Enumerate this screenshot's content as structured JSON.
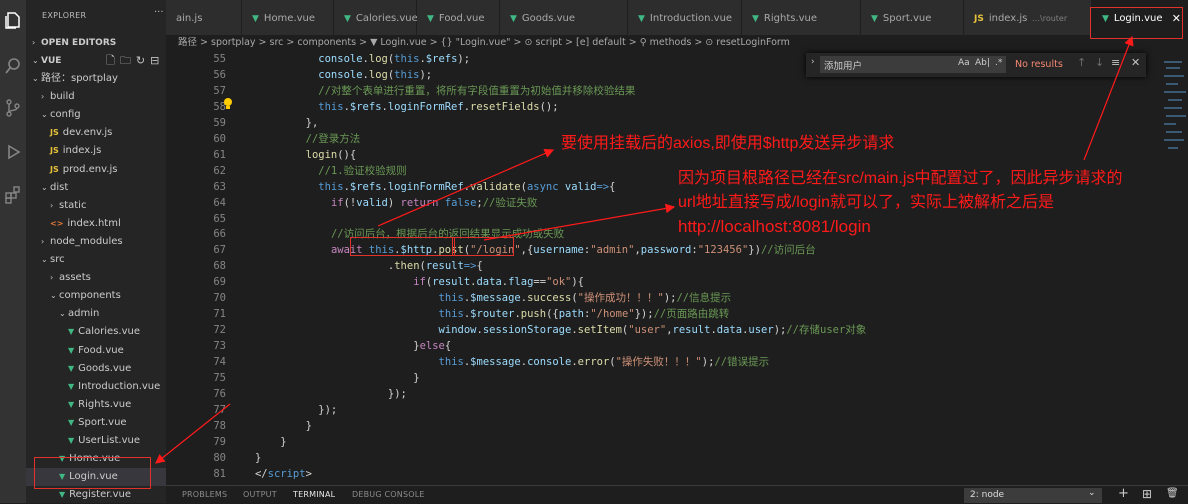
{
  "sidebar": {
    "title": "EXPLORER",
    "open_editors": "OPEN EDITORS",
    "root": "VUE",
    "tree": [
      {
        "label": "路径：sportplay",
        "type": "folder",
        "open": true,
        "depth": 1
      },
      {
        "label": "build",
        "type": "folder",
        "open": false,
        "depth": 2
      },
      {
        "label": "config",
        "type": "folder",
        "open": true,
        "depth": 2
      },
      {
        "label": "dev.env.js",
        "type": "js",
        "depth": 3
      },
      {
        "label": "index.js",
        "type": "js",
        "depth": 3
      },
      {
        "label": "prod.env.js",
        "type": "js",
        "depth": 3
      },
      {
        "label": "dist",
        "type": "folder",
        "open": true,
        "depth": 2
      },
      {
        "label": "static",
        "type": "folder",
        "open": false,
        "depth": 3
      },
      {
        "label": "index.html",
        "type": "html",
        "depth": 3
      },
      {
        "label": "node_modules",
        "type": "folder",
        "open": false,
        "depth": 2
      },
      {
        "label": "src",
        "type": "folder",
        "open": true,
        "depth": 2
      },
      {
        "label": "assets",
        "type": "folder",
        "open": false,
        "depth": 3
      },
      {
        "label": "components",
        "type": "folder",
        "open": true,
        "depth": 3
      },
      {
        "label": "admin",
        "type": "folder",
        "open": true,
        "depth": 4
      },
      {
        "label": "Calories.vue",
        "type": "vue",
        "depth": 5
      },
      {
        "label": "Food.vue",
        "type": "vue",
        "depth": 5
      },
      {
        "label": "Goods.vue",
        "type": "vue",
        "depth": 5
      },
      {
        "label": "Introduction.vue",
        "type": "vue",
        "depth": 5
      },
      {
        "label": "Rights.vue",
        "type": "vue",
        "depth": 5
      },
      {
        "label": "Sport.vue",
        "type": "vue",
        "depth": 5
      },
      {
        "label": "UserList.vue",
        "type": "vue",
        "depth": 5
      },
      {
        "label": "Home.vue",
        "type": "vue",
        "depth": 4
      },
      {
        "label": "Login.vue",
        "type": "vue",
        "depth": 4,
        "selected": true
      },
      {
        "label": "Register.vue",
        "type": "vue",
        "depth": 4
      }
    ]
  },
  "tabs": [
    {
      "label": "main.js",
      "icon": "JS",
      "type": "js",
      "visible_label": "ain.js"
    },
    {
      "label": "Home.vue",
      "icon": "V",
      "type": "vue"
    },
    {
      "label": "Calories.vue",
      "icon": "V",
      "type": "vue"
    },
    {
      "label": "Food.vue",
      "icon": "V",
      "type": "vue"
    },
    {
      "label": "Goods.vue",
      "icon": "V",
      "type": "vue"
    },
    {
      "label": "Introduction.vue",
      "icon": "V",
      "type": "vue"
    },
    {
      "label": "Rights.vue",
      "icon": "V",
      "type": "vue"
    },
    {
      "label": "Sport.vue",
      "icon": "V",
      "type": "vue"
    },
    {
      "label": "index.js",
      "icon": "JS",
      "type": "js",
      "suffix": "...\\router"
    },
    {
      "label": "Login.vue",
      "icon": "V",
      "type": "vue",
      "active": true
    }
  ],
  "breadcrumb": "路径 > sportplay > src > components > ▼ Login.vue > {} \"Login.vue\" > ⊙ script > [e] default > ⚲ methods > ⊙ resetLoginForm",
  "find": {
    "value": "添加用户",
    "case_label": "Aa",
    "word_label": "Ab|",
    "regex_label": ".*",
    "result": "No results"
  },
  "code": [
    {
      "n": "55",
      "indent": 13,
      "tokens": [
        [
          "c-prop",
          "console"
        ],
        [
          "c-txt",
          "."
        ],
        [
          "c-fn",
          "log"
        ],
        [
          "c-txt",
          "("
        ],
        [
          "c-this",
          "this"
        ],
        [
          "c-txt",
          "."
        ],
        [
          "c-prop",
          "$refs"
        ],
        [
          "c-txt",
          ");"
        ]
      ]
    },
    {
      "n": "56",
      "indent": 13,
      "tokens": [
        [
          "c-prop",
          "console"
        ],
        [
          "c-txt",
          "."
        ],
        [
          "c-fn",
          "log"
        ],
        [
          "c-txt",
          "("
        ],
        [
          "c-this",
          "this"
        ],
        [
          "c-txt",
          ");"
        ]
      ]
    },
    {
      "n": "57",
      "indent": 13,
      "tokens": [
        [
          "c-cm",
          "//对整个表单进行重置，将所有字段值重置为初始值并移除校验结果"
        ]
      ]
    },
    {
      "n": "58",
      "indent": 13,
      "tokens": [
        [
          "c-this",
          "this"
        ],
        [
          "c-txt",
          "."
        ],
        [
          "c-prop",
          "$refs"
        ],
        [
          "c-txt",
          "."
        ],
        [
          "c-prop",
          "loginFormRef"
        ],
        [
          "c-txt",
          "."
        ],
        [
          "c-fn",
          "resetFields"
        ],
        [
          "c-txt",
          "();"
        ]
      ]
    },
    {
      "n": "59",
      "indent": 11,
      "tokens": [
        [
          "c-txt",
          "},"
        ]
      ]
    },
    {
      "n": "60",
      "indent": 11,
      "tokens": [
        [
          "c-cm",
          "//登录方法"
        ]
      ]
    },
    {
      "n": "61",
      "indent": 11,
      "tokens": [
        [
          "c-fn",
          "login"
        ],
        [
          "c-txt",
          "(){"
        ]
      ]
    },
    {
      "n": "62",
      "indent": 13,
      "tokens": [
        [
          "c-cm",
          "//1.验证校验规则"
        ]
      ]
    },
    {
      "n": "63",
      "indent": 13,
      "tokens": [
        [
          "c-this",
          "this"
        ],
        [
          "c-txt",
          "."
        ],
        [
          "c-prop",
          "$refs"
        ],
        [
          "c-txt",
          "."
        ],
        [
          "c-prop",
          "loginFormRef"
        ],
        [
          "c-txt",
          "."
        ],
        [
          "c-fn",
          "validate"
        ],
        [
          "c-txt",
          "("
        ],
        [
          "c-kw2",
          "async"
        ],
        [
          "c-txt",
          " "
        ],
        [
          "c-prop",
          "valid"
        ],
        [
          "c-kw2",
          "=>"
        ],
        [
          "c-txt",
          "{"
        ]
      ]
    },
    {
      "n": "64",
      "indent": 15,
      "tokens": [
        [
          "c-kw",
          "if"
        ],
        [
          "c-txt",
          "(!"
        ],
        [
          "c-prop",
          "valid"
        ],
        [
          "c-txt",
          ") "
        ],
        [
          "c-kw",
          "return"
        ],
        [
          "c-txt",
          " "
        ],
        [
          "c-kw2",
          "false"
        ],
        [
          "c-txt",
          ";"
        ],
        [
          "c-cm",
          "//验证失败"
        ]
      ]
    },
    {
      "n": "65",
      "indent": 0,
      "tokens": []
    },
    {
      "n": "66",
      "indent": 15,
      "tokens": [
        [
          "c-cm",
          "//访问后台，根据后台的返回结果显示成功或失败"
        ]
      ]
    },
    {
      "n": "67",
      "indent": 15,
      "tokens": [
        [
          "c-kw",
          "await"
        ],
        [
          "c-txt",
          " "
        ],
        [
          "c-this",
          "this"
        ],
        [
          "c-txt",
          "."
        ],
        [
          "c-prop",
          "$http"
        ],
        [
          "c-txt",
          "."
        ],
        [
          "c-fn",
          "post"
        ],
        [
          "c-txt",
          "("
        ],
        [
          "c-str",
          "\"/login\""
        ],
        [
          "c-txt",
          ",{"
        ],
        [
          "c-prop",
          "username"
        ],
        [
          "c-txt",
          ":"
        ],
        [
          "c-str",
          "\"admin\""
        ],
        [
          "c-txt",
          ","
        ],
        [
          "c-prop",
          "password"
        ],
        [
          "c-txt",
          ":"
        ],
        [
          "c-str",
          "\"123456\""
        ],
        [
          "c-txt",
          "})"
        ],
        [
          "c-cm",
          "//访问后台"
        ]
      ]
    },
    {
      "n": "68",
      "indent": 24,
      "tokens": [
        [
          "c-txt",
          "."
        ],
        [
          "c-fn",
          "then"
        ],
        [
          "c-txt",
          "("
        ],
        [
          "c-prop",
          "result"
        ],
        [
          "c-kw2",
          "=>"
        ],
        [
          "c-txt",
          "{"
        ]
      ]
    },
    {
      "n": "69",
      "indent": 28,
      "tokens": [
        [
          "c-kw",
          "if"
        ],
        [
          "c-txt",
          "("
        ],
        [
          "c-prop",
          "result"
        ],
        [
          "c-txt",
          "."
        ],
        [
          "c-prop",
          "data"
        ],
        [
          "c-txt",
          "."
        ],
        [
          "c-prop",
          "flag"
        ],
        [
          "c-txt",
          "=="
        ],
        [
          "c-str",
          "\"ok\""
        ],
        [
          "c-txt",
          "){"
        ]
      ]
    },
    {
      "n": "70",
      "indent": 32,
      "tokens": [
        [
          "c-this",
          "this"
        ],
        [
          "c-txt",
          "."
        ],
        [
          "c-prop",
          "$message"
        ],
        [
          "c-txt",
          "."
        ],
        [
          "c-fn",
          "success"
        ],
        [
          "c-txt",
          "("
        ],
        [
          "c-str",
          "\"操作成功！！！\""
        ],
        [
          "c-txt",
          ");"
        ],
        [
          "c-cm",
          "//信息提示"
        ]
      ]
    },
    {
      "n": "71",
      "indent": 32,
      "tokens": [
        [
          "c-this",
          "this"
        ],
        [
          "c-txt",
          "."
        ],
        [
          "c-prop",
          "$router"
        ],
        [
          "c-txt",
          "."
        ],
        [
          "c-fn",
          "push"
        ],
        [
          "c-txt",
          "({"
        ],
        [
          "c-prop",
          "path"
        ],
        [
          "c-txt",
          ":"
        ],
        [
          "c-str",
          "\"/home\""
        ],
        [
          "c-txt",
          "});"
        ],
        [
          "c-cm",
          "//页面路由跳转"
        ]
      ]
    },
    {
      "n": "72",
      "indent": 32,
      "tokens": [
        [
          "c-prop",
          "window"
        ],
        [
          "c-txt",
          "."
        ],
        [
          "c-prop",
          "sessionStorage"
        ],
        [
          "c-txt",
          "."
        ],
        [
          "c-fn",
          "setItem"
        ],
        [
          "c-txt",
          "("
        ],
        [
          "c-str",
          "\"user\""
        ],
        [
          "c-txt",
          ","
        ],
        [
          "c-prop",
          "result"
        ],
        [
          "c-txt",
          "."
        ],
        [
          "c-prop",
          "data"
        ],
        [
          "c-txt",
          "."
        ],
        [
          "c-prop",
          "user"
        ],
        [
          "c-txt",
          ");"
        ],
        [
          "c-cm",
          "//存储user对象"
        ]
      ]
    },
    {
      "n": "73",
      "indent": 28,
      "tokens": [
        [
          "c-txt",
          "}"
        ],
        [
          "c-kw",
          "else"
        ],
        [
          "c-txt",
          "{"
        ]
      ]
    },
    {
      "n": "74",
      "indent": 32,
      "tokens": [
        [
          "c-this",
          "this"
        ],
        [
          "c-txt",
          "."
        ],
        [
          "c-prop",
          "$message"
        ],
        [
          "c-txt",
          "."
        ],
        [
          "c-prop",
          "console"
        ],
        [
          "c-txt",
          "."
        ],
        [
          "c-fn",
          "error"
        ],
        [
          "c-txt",
          "("
        ],
        [
          "c-str",
          "\"操作失败！！！\""
        ],
        [
          "c-txt",
          ");"
        ],
        [
          "c-cm",
          "//错误提示"
        ]
      ]
    },
    {
      "n": "75",
      "indent": 28,
      "tokens": [
        [
          "c-txt",
          "}"
        ]
      ]
    },
    {
      "n": "76",
      "indent": 24,
      "tokens": [
        [
          "c-txt",
          "});"
        ]
      ]
    },
    {
      "n": "77",
      "indent": 13,
      "tokens": [
        [
          "c-txt",
          "});"
        ]
      ]
    },
    {
      "n": "78",
      "indent": 11,
      "tokens": [
        [
          "c-txt",
          "}"
        ]
      ]
    },
    {
      "n": "79",
      "indent": 7,
      "tokens": [
        [
          "c-txt",
          "}"
        ]
      ]
    },
    {
      "n": "80",
      "indent": 3,
      "tokens": [
        [
          "c-txt",
          "}"
        ]
      ]
    },
    {
      "n": "81",
      "indent": 3,
      "tokens": [
        [
          "c-txt",
          "</"
        ],
        [
          "c-kw2",
          "script"
        ],
        [
          "c-txt",
          ">"
        ]
      ]
    },
    {
      "n": "82",
      "indent": 3,
      "tokens": [
        [
          "c-txt",
          "<"
        ],
        [
          "c-kw2",
          "style"
        ],
        [
          "c-txt",
          " "
        ],
        [
          "c-prop",
          "scoped"
        ],
        [
          "c-txt",
          ">"
        ]
      ]
    }
  ],
  "annotations": {
    "a1": "要使用挂载后的axios,即使用$http发送异步请求",
    "a2_line1": "因为项目根路径已经在src/main.js中配置过了，因此异步请求的",
    "a2_line2": "url地址直接写成/login就可以了，实际上被解析之后是",
    "a2_line3": "http://localhost:8081/login"
  },
  "panel": {
    "tabs": [
      "PROBLEMS",
      "OUTPUT",
      "TERMINAL",
      "DEBUG CONSOLE"
    ],
    "active": "TERMINAL",
    "terminal_select": "2: node",
    "plus": "+",
    "split": "⊞",
    "trash": "🗑"
  },
  "colors": {
    "accent": "#ff1a1a",
    "vue": "#41b883",
    "js": "#e8c33a"
  }
}
